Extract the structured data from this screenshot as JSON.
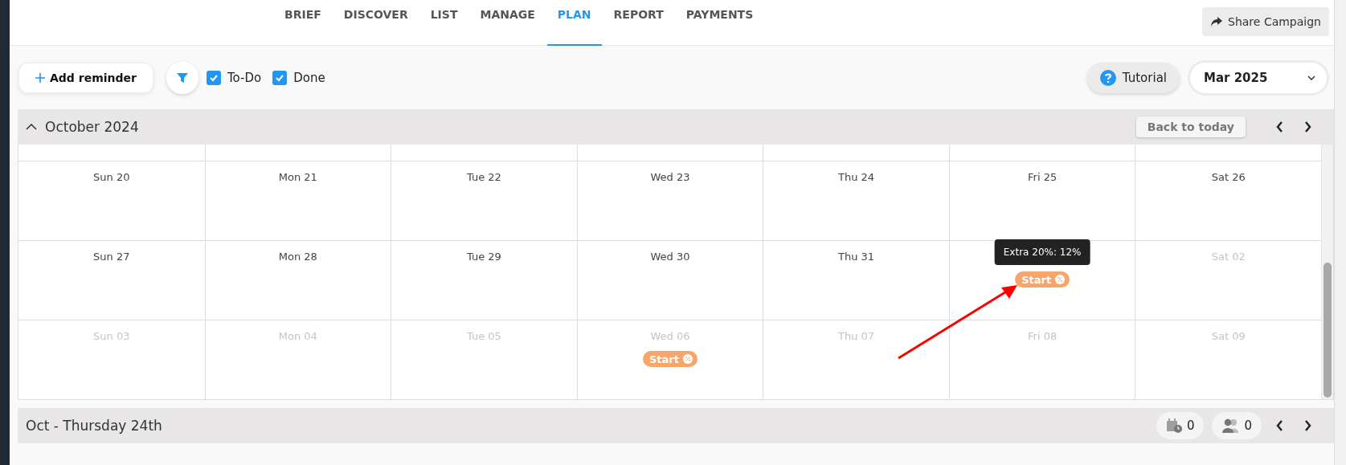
{
  "nav": {
    "tabs": [
      {
        "label": "BRIEF",
        "selected": false
      },
      {
        "label": "DISCOVER",
        "selected": false
      },
      {
        "label": "LIST",
        "selected": false
      },
      {
        "label": "MANAGE",
        "selected": false
      },
      {
        "label": "PLAN",
        "selected": true
      },
      {
        "label": "REPORT",
        "selected": false
      },
      {
        "label": "PAYMENTS",
        "selected": false
      }
    ],
    "share_button": "Share Campaign"
  },
  "toolbar": {
    "add_button": "Add reminder",
    "filters": [
      {
        "label": "To-Do",
        "checked": true
      },
      {
        "label": "Done",
        "checked": true
      }
    ],
    "tutorial_button": "Tutorial",
    "month_select": {
      "value": "Mar 2025"
    }
  },
  "calendar": {
    "title": "October 2024",
    "expanded": true,
    "back_button": "Back to today",
    "rows": [
      [
        {
          "label": "Sun 20",
          "muted": false
        },
        {
          "label": "Mon 21",
          "muted": false
        },
        {
          "label": "Tue 22",
          "muted": false
        },
        {
          "label": "Wed 23",
          "muted": false
        },
        {
          "label": "Thu 24",
          "muted": false
        },
        {
          "label": "Fri 25",
          "muted": false
        },
        {
          "label": "Sat 26",
          "muted": false
        }
      ],
      [
        {
          "label": "Sun 27",
          "muted": false
        },
        {
          "label": "Mon 28",
          "muted": false
        },
        {
          "label": "Tue 29",
          "muted": false
        },
        {
          "label": "Wed 30",
          "muted": false
        },
        {
          "label": "Thu 31",
          "muted": false
        },
        {
          "events": [
            {
              "label": "Start",
              "tooltip": "Extra 20%: 12%"
            }
          ]
        },
        {
          "label": "Sat 02",
          "muted": true
        }
      ],
      [
        {
          "label": "Sun 03",
          "muted": true
        },
        {
          "label": "Mon 04",
          "muted": true
        },
        {
          "label": "Tue 05",
          "muted": true
        },
        {
          "label": "Wed 06",
          "muted": true,
          "events": [
            {
              "label": "Start"
            }
          ]
        },
        {
          "label": "Thu 07",
          "muted": true
        },
        {
          "label": "Fri 08",
          "muted": true
        },
        {
          "label": "Sat 09",
          "muted": true
        }
      ]
    ]
  },
  "footer": {
    "title": "Oct - Thursday 24th",
    "counters": [
      {
        "kind": "reminders",
        "value": "0"
      },
      {
        "kind": "people",
        "value": "0"
      }
    ]
  }
}
